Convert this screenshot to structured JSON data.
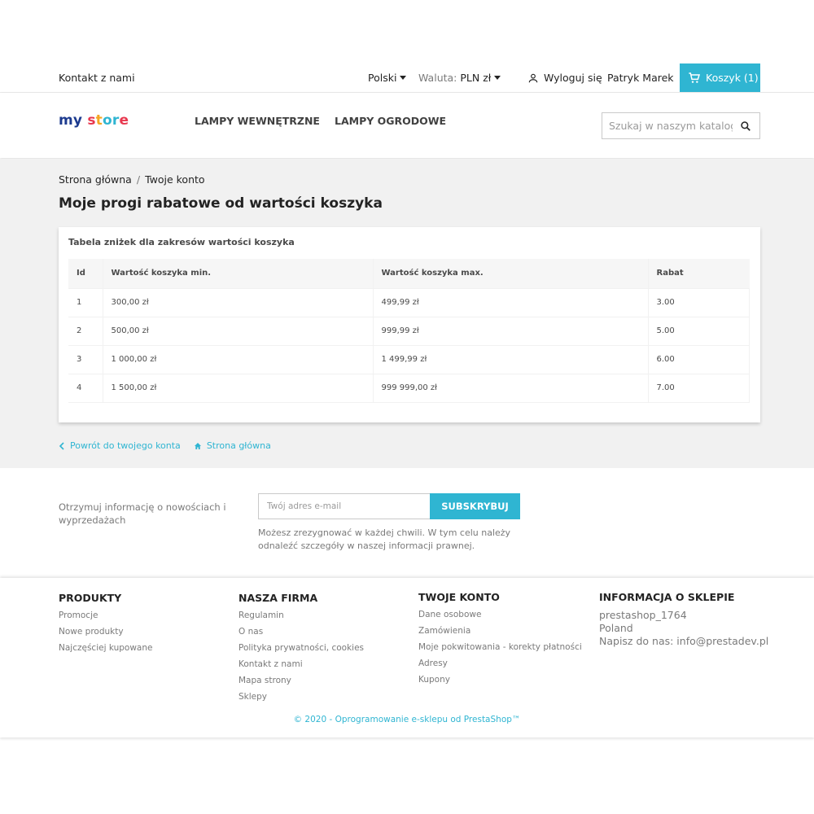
{
  "topbar": {
    "contact": "Kontakt z nami",
    "language": "Polski",
    "currency_label": "Waluta:",
    "currency_value": "PLN zł",
    "logout": "Wyloguj się",
    "username": "Patryk Marek",
    "cart": "Koszyk (1)"
  },
  "header": {
    "logo": {
      "part1": "my",
      "part2": "s",
      "part3": "t",
      "part4": "or",
      "part5": "e"
    },
    "nav": [
      "LAMPY WEWNĘTRZNE",
      "LAMPY OGRODOWE"
    ],
    "search_placeholder": "Szukaj w naszym katalogu"
  },
  "breadcrumb": [
    "Strona główna",
    "Twoje konto"
  ],
  "page_title": "Moje progi rabatowe od wartości koszyka",
  "card": {
    "title": "Tabela zniżek dla zakresów wartości koszyka",
    "columns": [
      "Id",
      "Wartość koszyka min.",
      "Wartość koszyka max.",
      "Rabat"
    ],
    "rows": [
      [
        "1",
        "300,00 zł",
        "499,99 zł",
        "3.00"
      ],
      [
        "2",
        "500,00 zł",
        "999,99 zł",
        "5.00"
      ],
      [
        "3",
        "1 000,00 zł",
        "1 499,99 zł",
        "6.00"
      ],
      [
        "4",
        "1 500,00 zł",
        "999 999,00 zł",
        "7.00"
      ]
    ]
  },
  "links": {
    "back_account": "Powrót do twojego konta",
    "home": "Strona główna"
  },
  "newsletter": {
    "label": "Otrzymuj informację o nowościach i wyprzedażach",
    "placeholder": "Twój adres e-mail",
    "button": "SUBSKRYBUJ",
    "note": "Możesz zrezygnować w każdej chwili. W tym celu należy odnaleźć szczegóły w naszej informacji prawnej."
  },
  "footer": {
    "products": {
      "title": "PRODUKTY",
      "items": [
        "Promocje",
        "Nowe produkty",
        "Najczęściej kupowane"
      ]
    },
    "company": {
      "title": "NASZA FIRMA",
      "items": [
        "Regulamin",
        "O nas",
        "Polityka prywatności, cookies",
        "Kontakt z nami",
        "Mapa strony",
        "Sklepy"
      ]
    },
    "account": {
      "title": "TWOJE KONTO",
      "items": [
        "Dane osobowe",
        "Zamówienia",
        "Moje pokwitowania - korekty płatności",
        "Adresy",
        "Kupony"
      ]
    },
    "store_info": {
      "title": "INFORMACJA O SKLEPIE",
      "items": [
        "prestashop_1764",
        "Poland",
        "Napisz do nas: info@prestadev.pl"
      ]
    },
    "copyright": "© 2020 - Oprogramowanie e-sklepu od PrestaShop™"
  },
  "colors": {
    "accent": "#2fb5d2",
    "background_main": "#f1f1f1",
    "text": "#232323",
    "muted": "#7a7a7a"
  },
  "icons": {
    "user": "user-icon",
    "cart": "cart-icon",
    "search": "search-icon",
    "chevron_left": "chevron-left-icon",
    "home": "home-icon",
    "caret": "caret-down-icon"
  }
}
